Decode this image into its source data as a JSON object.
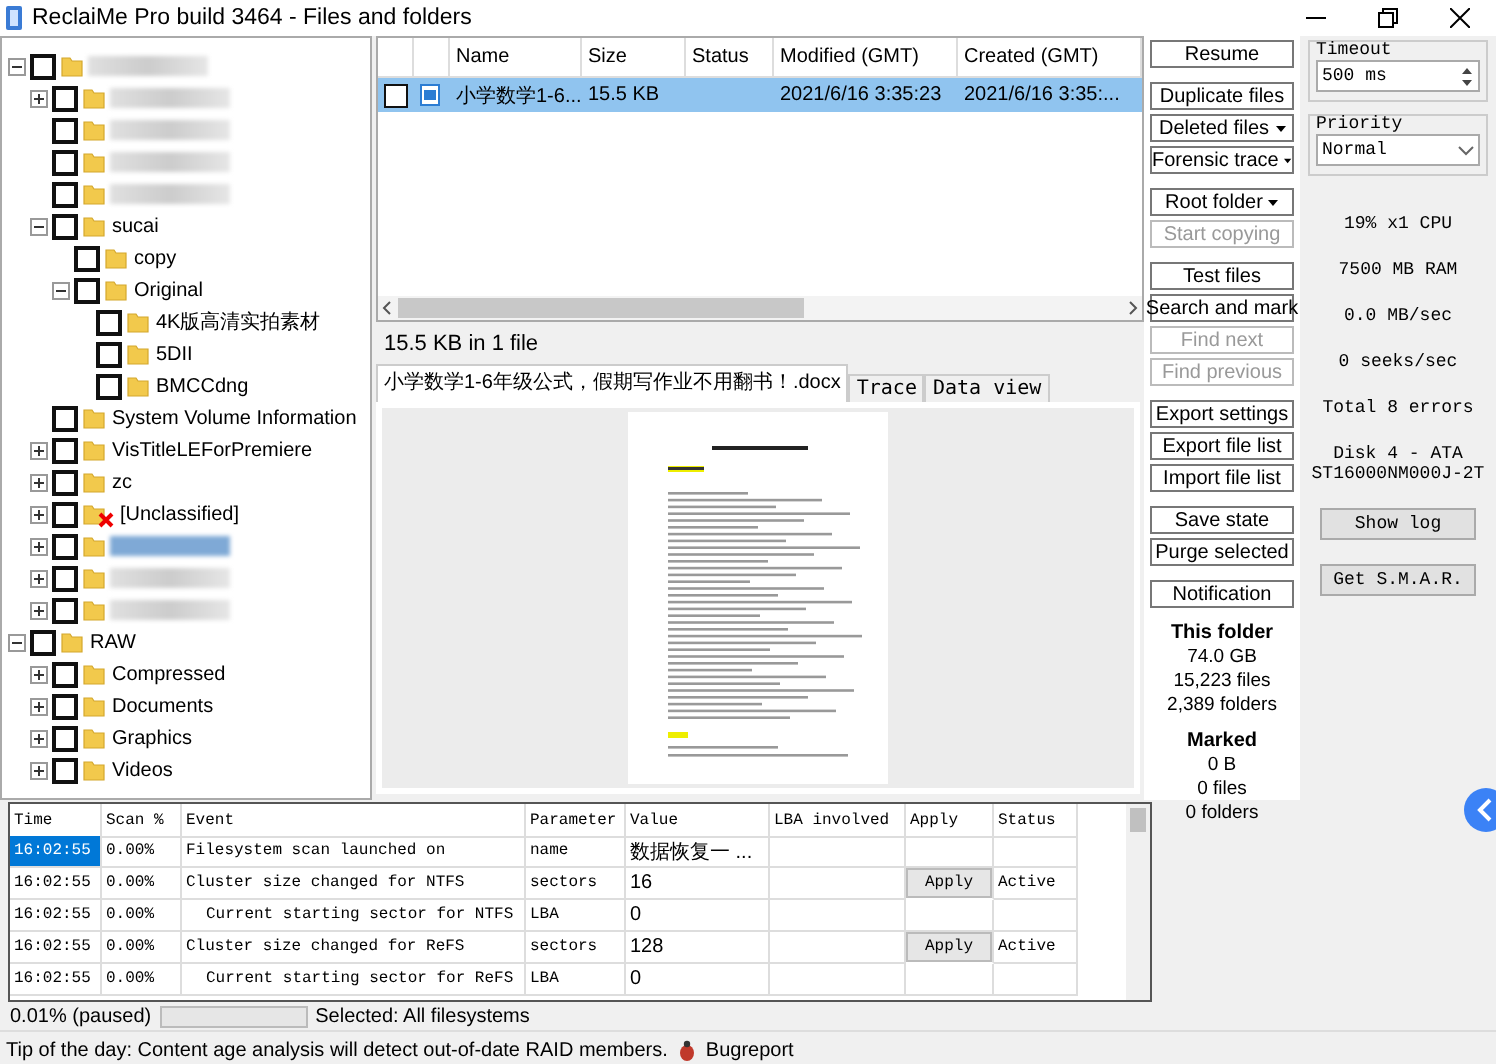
{
  "window": {
    "title": "ReclaiMe Pro build 3464 - Files and folders"
  },
  "tree": [
    {
      "blurred": true,
      "expanded": true,
      "checked": false,
      "children": [
        {
          "blurred": true,
          "expanded": false,
          "checked": false
        },
        {
          "blurred": true,
          "checked": false
        },
        {
          "blurred": true,
          "checked": false
        },
        {
          "blurred": true,
          "checked": false
        },
        {
          "label": "sucai",
          "expanded": true,
          "checked": false,
          "children": [
            {
              "label": "copy",
              "checked": false
            },
            {
              "label": "Original",
              "expanded": true,
              "checked": false,
              "children": [
                {
                  "label": "4K版高清实拍素材",
                  "checked": false
                },
                {
                  "label": "5DII",
                  "checked": false
                },
                {
                  "label": "BMCCdng",
                  "checked": false
                }
              ]
            }
          ]
        },
        {
          "label": "System Volume Information",
          "checked": false
        },
        {
          "label": "VisTitleLEForPremiere",
          "expanded": false,
          "checked": false
        },
        {
          "label": "zc",
          "expanded": false,
          "checked": false
        },
        {
          "label": "[Unclassified]",
          "expanded": false,
          "checked": false,
          "deleted": true
        },
        {
          "blurred": true,
          "expanded": false,
          "checked": false,
          "selected": true
        },
        {
          "blurred": true,
          "expanded": false,
          "checked": false
        },
        {
          "blurred": true,
          "expanded": false,
          "checked": false
        }
      ]
    },
    {
      "label": "RAW",
      "expanded": true,
      "checked": false,
      "children": [
        {
          "label": "Compressed",
          "expanded": false,
          "checked": false
        },
        {
          "label": "Documents",
          "expanded": false,
          "checked": false
        },
        {
          "label": "Graphics",
          "expanded": false,
          "checked": false
        },
        {
          "label": "Videos",
          "expanded": false,
          "checked": false
        }
      ]
    }
  ],
  "files": {
    "columns": [
      "Name",
      "Size",
      "Status",
      "Modified (GMT)",
      "Created (GMT)"
    ],
    "rows": [
      {
        "checked": false,
        "selected": true,
        "name": "小学数学1-6...",
        "size": "15.5 KB",
        "modified": "2021/6/16 3:35:23",
        "created": "2021/6/16 3:35:..."
      }
    ],
    "summary": "15.5 KB in 1 file"
  },
  "tabs": [
    {
      "label": "小学数学1-6年级公式，假期写作业不用翻书！.docx",
      "selected": true
    },
    {
      "label": "Trace",
      "selected": false
    },
    {
      "label": "Data view",
      "selected": false
    }
  ],
  "button_groups": [
    [
      {
        "label": "Resume",
        "disabled": false,
        "dropdown": false
      }
    ],
    [
      {
        "label": "Duplicate files",
        "disabled": false,
        "dropdown": false
      },
      {
        "label": "Deleted files",
        "disabled": false,
        "dropdown": true
      },
      {
        "label": "Forensic trace",
        "disabled": false,
        "dropdown": true
      }
    ],
    [
      {
        "label": "Root folder",
        "disabled": false,
        "dropdown": true
      },
      {
        "label": "Start copying",
        "disabled": true,
        "dropdown": false
      }
    ],
    [
      {
        "label": "Test files",
        "disabled": false,
        "dropdown": false
      },
      {
        "label": "Search and mark",
        "disabled": false,
        "dropdown": false
      },
      {
        "label": "Find next",
        "disabled": true,
        "dropdown": false
      },
      {
        "label": "Find previous",
        "disabled": true,
        "dropdown": false
      }
    ],
    [
      {
        "label": "Export settings",
        "disabled": false,
        "dropdown": false
      },
      {
        "label": "Export file list",
        "disabled": false,
        "dropdown": false
      },
      {
        "label": "Import file list",
        "disabled": false,
        "dropdown": false
      }
    ],
    [
      {
        "label": "Save state",
        "disabled": false,
        "dropdown": false
      },
      {
        "label": "Purge selected",
        "disabled": false,
        "dropdown": false
      }
    ],
    [
      {
        "label": "Notification",
        "disabled": false,
        "dropdown": false
      }
    ]
  ],
  "this_folder": {
    "title": "This folder",
    "lines": [
      "74.0 GB",
      "15,223 files",
      "2,389 folders"
    ]
  },
  "marked": {
    "title": "Marked",
    "lines": [
      "0 B",
      "0 files",
      "0 folders"
    ]
  },
  "settings": {
    "timeout_label": "Timeout",
    "timeout_value": "500 ms",
    "priority_label": "Priority",
    "priority_value": "Normal"
  },
  "stats": [
    "19% x1 CPU",
    "7500 MB RAM",
    "0.0 MB/sec",
    "0 seeks/sec",
    "Total 8 errors",
    "Disk 4 - ATA",
    "ST16000NM000J-2T"
  ],
  "side_buttons": [
    "Show log",
    "Get S.M.A.R."
  ],
  "log": {
    "columns": [
      "Time",
      "Scan %",
      "Event",
      "Parameter",
      "Value",
      "LBA involved",
      "Apply",
      "Status"
    ],
    "rows": [
      {
        "time": "16:02:55",
        "scan": "0.00%",
        "event": "Filesystem scan launched on",
        "kind": "main",
        "parameter": "name",
        "value": "数据恢复一 ...",
        "apply": "",
        "status": "",
        "selected": true
      },
      {
        "time": "16:02:55",
        "scan": "0.00%",
        "event": "Cluster size changed for NTFS",
        "kind": "main",
        "parameter": "sectors",
        "value": "16",
        "apply": "Apply",
        "status": "Active",
        "selected": false
      },
      {
        "time": "16:02:55",
        "scan": "0.00%",
        "event": "Current starting sector for NTFS",
        "kind": "detail",
        "parameter": "LBA",
        "value": "0",
        "apply": "",
        "status": "",
        "selected": false
      },
      {
        "time": "16:02:55",
        "scan": "0.00%",
        "event": "Cluster size changed for ReFS",
        "kind": "main",
        "parameter": "sectors",
        "value": "128",
        "apply": "Apply",
        "status": "Active",
        "selected": false
      },
      {
        "time": "16:02:55",
        "scan": "0.00%",
        "event": "Current starting sector for ReFS",
        "kind": "detail",
        "parameter": "LBA",
        "value": "0",
        "apply": "",
        "status": "",
        "selected": false
      }
    ]
  },
  "progress": {
    "text": "0.01% (paused)",
    "level": 0.0001,
    "selected": "Selected: All filesystems"
  },
  "tip": {
    "text": "Tip of the day: Content age analysis will detect out-of-date RAID members.",
    "link": "Bugreport"
  }
}
